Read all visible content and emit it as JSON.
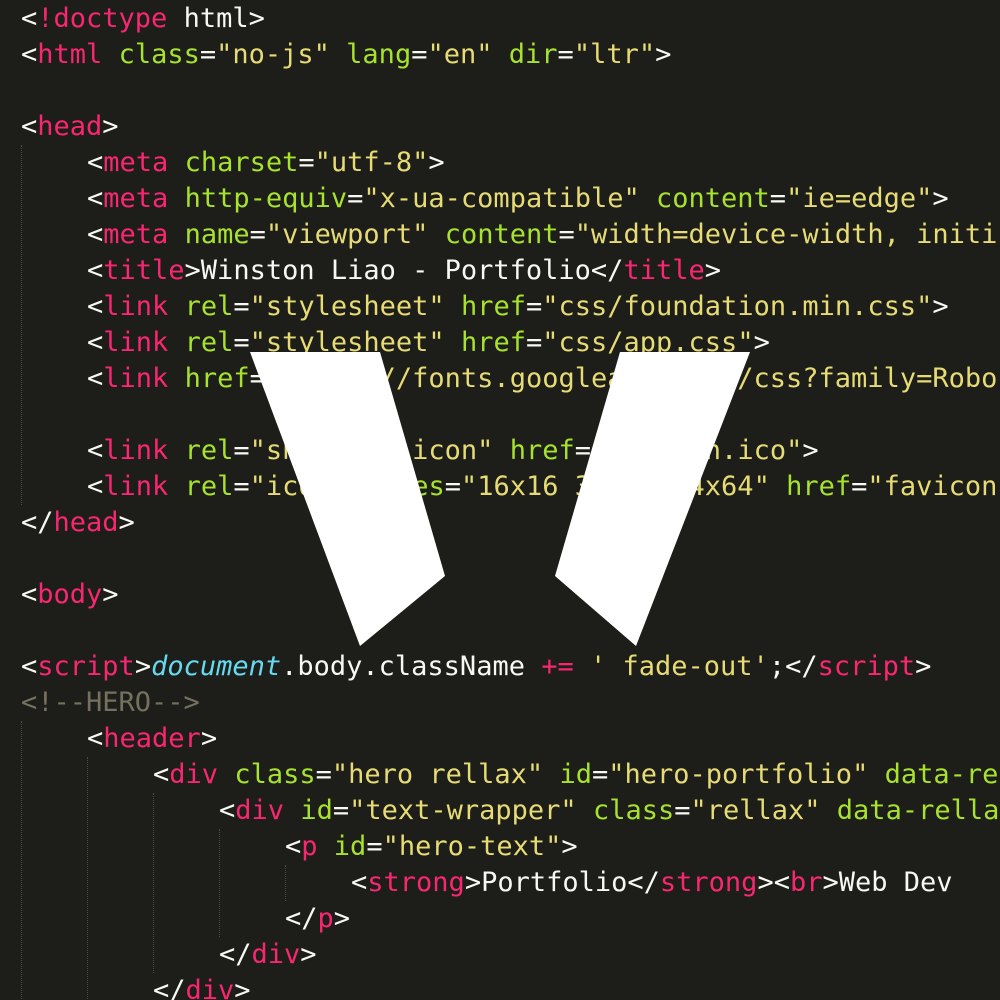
{
  "colors": {
    "background": "#1d1e19",
    "punctuation": "#f8f8f2",
    "tag": "#f92672",
    "attribute": "#a6e22e",
    "string": "#e6db74",
    "comment": "#75715e",
    "keyword": "#f92672",
    "builtin": "#66d9ef",
    "logo": "#ffffff"
  },
  "logo": {
    "icon": "white-chevron-logo-icon",
    "color": "#ffffff"
  },
  "lines": [
    {
      "indent": 0,
      "tokens": [
        [
          "p",
          "<"
        ],
        [
          "t",
          "!doctype"
        ],
        [
          "p",
          " html>"
        ]
      ]
    },
    {
      "indent": 0,
      "tokens": [
        [
          "p",
          "<"
        ],
        [
          "t",
          "html"
        ],
        [
          "p",
          " "
        ],
        [
          "a",
          "class"
        ],
        [
          "p",
          "="
        ],
        [
          "s",
          "\"no-js\""
        ],
        [
          "p",
          " "
        ],
        [
          "a",
          "lang"
        ],
        [
          "p",
          "="
        ],
        [
          "s",
          "\"en\""
        ],
        [
          "p",
          " "
        ],
        [
          "a",
          "dir"
        ],
        [
          "p",
          "="
        ],
        [
          "s",
          "\"ltr\""
        ],
        [
          "p",
          ">"
        ]
      ]
    },
    {
      "indent": 0,
      "tokens": []
    },
    {
      "indent": 0,
      "tokens": [
        [
          "p",
          "<"
        ],
        [
          "t",
          "head"
        ],
        [
          "p",
          ">"
        ]
      ]
    },
    {
      "indent": 1,
      "tokens": [
        [
          "p",
          "<"
        ],
        [
          "t",
          "meta"
        ],
        [
          "p",
          " "
        ],
        [
          "a",
          "charset"
        ],
        [
          "p",
          "="
        ],
        [
          "s",
          "\"utf-8\""
        ],
        [
          "p",
          ">"
        ]
      ]
    },
    {
      "indent": 1,
      "tokens": [
        [
          "p",
          "<"
        ],
        [
          "t",
          "meta"
        ],
        [
          "p",
          " "
        ],
        [
          "a",
          "http-equiv"
        ],
        [
          "p",
          "="
        ],
        [
          "s",
          "\"x-ua-compatible\""
        ],
        [
          "p",
          " "
        ],
        [
          "a",
          "content"
        ],
        [
          "p",
          "="
        ],
        [
          "s",
          "\"ie=edge\""
        ],
        [
          "p",
          ">"
        ]
      ]
    },
    {
      "indent": 1,
      "tokens": [
        [
          "p",
          "<"
        ],
        [
          "t",
          "meta"
        ],
        [
          "p",
          " "
        ],
        [
          "a",
          "name"
        ],
        [
          "p",
          "="
        ],
        [
          "s",
          "\"viewport\""
        ],
        [
          "p",
          " "
        ],
        [
          "a",
          "content"
        ],
        [
          "p",
          "="
        ],
        [
          "s",
          "\"width=device-width, initi"
        ]
      ]
    },
    {
      "indent": 1,
      "tokens": [
        [
          "p",
          "<"
        ],
        [
          "t",
          "title"
        ],
        [
          "p",
          ">Winston Liao - Portfolio</"
        ],
        [
          "t",
          "title"
        ],
        [
          "p",
          ">"
        ]
      ]
    },
    {
      "indent": 1,
      "tokens": [
        [
          "p",
          "<"
        ],
        [
          "t",
          "link"
        ],
        [
          "p",
          " "
        ],
        [
          "a",
          "rel"
        ],
        [
          "p",
          "="
        ],
        [
          "s",
          "\"stylesheet\""
        ],
        [
          "p",
          " "
        ],
        [
          "a",
          "href"
        ],
        [
          "p",
          "="
        ],
        [
          "s",
          "\"css/foundation.min.css\""
        ],
        [
          "p",
          ">"
        ]
      ]
    },
    {
      "indent": 1,
      "tokens": [
        [
          "p",
          "<"
        ],
        [
          "t",
          "link"
        ],
        [
          "p",
          " "
        ],
        [
          "a",
          "rel"
        ],
        [
          "p",
          "="
        ],
        [
          "s",
          "\"stylesheet\""
        ],
        [
          "p",
          " "
        ],
        [
          "a",
          "href"
        ],
        [
          "p",
          "="
        ],
        [
          "s",
          "\"css/app.css\""
        ],
        [
          "p",
          ">"
        ]
      ]
    },
    {
      "indent": 1,
      "tokens": [
        [
          "p",
          "<"
        ],
        [
          "t",
          "link"
        ],
        [
          "p",
          " "
        ],
        [
          "a",
          "href"
        ],
        [
          "p",
          "="
        ],
        [
          "s",
          "\"https://fonts.googleapis.com/css?family=Robo"
        ]
      ]
    },
    {
      "indent": 1,
      "tokens": []
    },
    {
      "indent": 1,
      "tokens": [
        [
          "p",
          "<"
        ],
        [
          "t",
          "link"
        ],
        [
          "p",
          " "
        ],
        [
          "a",
          "rel"
        ],
        [
          "p",
          "="
        ],
        [
          "s",
          "\"shortcut icon\""
        ],
        [
          "p",
          " "
        ],
        [
          "a",
          "href"
        ],
        [
          "p",
          "="
        ],
        [
          "s",
          "\"favicon.ico\""
        ],
        [
          "p",
          ">"
        ]
      ]
    },
    {
      "indent": 1,
      "tokens": [
        [
          "p",
          "<"
        ],
        [
          "t",
          "link"
        ],
        [
          "p",
          " "
        ],
        [
          "a",
          "rel"
        ],
        [
          "p",
          "="
        ],
        [
          "s",
          "\"icon\""
        ],
        [
          "p",
          " "
        ],
        [
          "a",
          "sizes"
        ],
        [
          "p",
          "="
        ],
        [
          "s",
          "\"16x16 32x32 64x64\""
        ],
        [
          "p",
          " "
        ],
        [
          "a",
          "href"
        ],
        [
          "p",
          "="
        ],
        [
          "s",
          "\"favicon"
        ]
      ]
    },
    {
      "indent": 0,
      "tokens": [
        [
          "p",
          "</"
        ],
        [
          "t",
          "head"
        ],
        [
          "p",
          ">"
        ]
      ]
    },
    {
      "indent": 0,
      "tokens": []
    },
    {
      "indent": 0,
      "tokens": [
        [
          "p",
          "<"
        ],
        [
          "t",
          "body"
        ],
        [
          "p",
          ">"
        ]
      ]
    },
    {
      "indent": 0,
      "tokens": []
    },
    {
      "indent": 0,
      "tokens": [
        [
          "p",
          "<"
        ],
        [
          "t",
          "script"
        ],
        [
          "p",
          ">"
        ],
        [
          "i",
          "document"
        ],
        [
          "p",
          ".body.className "
        ],
        [
          "k",
          "+="
        ],
        [
          "p",
          " "
        ],
        [
          "s",
          "' fade-out'"
        ],
        [
          "p",
          ";</"
        ],
        [
          "t",
          "script"
        ],
        [
          "p",
          ">"
        ]
      ]
    },
    {
      "indent": 0,
      "tokens": [
        [
          "c",
          "<!--HERO-->"
        ]
      ]
    },
    {
      "indent": 1,
      "tokens": [
        [
          "p",
          "<"
        ],
        [
          "t",
          "header"
        ],
        [
          "p",
          ">"
        ]
      ]
    },
    {
      "indent": 2,
      "tokens": [
        [
          "p",
          "<"
        ],
        [
          "t",
          "div"
        ],
        [
          "p",
          " "
        ],
        [
          "a",
          "class"
        ],
        [
          "p",
          "="
        ],
        [
          "s",
          "\"hero rellax\""
        ],
        [
          "p",
          " "
        ],
        [
          "a",
          "id"
        ],
        [
          "p",
          "="
        ],
        [
          "s",
          "\"hero-portfolio\""
        ],
        [
          "p",
          " "
        ],
        [
          "a",
          "data-re"
        ]
      ]
    },
    {
      "indent": 3,
      "tokens": [
        [
          "p",
          "<"
        ],
        [
          "t",
          "div"
        ],
        [
          "p",
          " "
        ],
        [
          "a",
          "id"
        ],
        [
          "p",
          "="
        ],
        [
          "s",
          "\"text-wrapper\""
        ],
        [
          "p",
          " "
        ],
        [
          "a",
          "class"
        ],
        [
          "p",
          "="
        ],
        [
          "s",
          "\"rellax\""
        ],
        [
          "p",
          " "
        ],
        [
          "a",
          "data-rella"
        ]
      ]
    },
    {
      "indent": 4,
      "tokens": [
        [
          "p",
          "<"
        ],
        [
          "t",
          "p"
        ],
        [
          "p",
          " "
        ],
        [
          "a",
          "id"
        ],
        [
          "p",
          "="
        ],
        [
          "s",
          "\"hero-text\""
        ],
        [
          "p",
          ">"
        ]
      ]
    },
    {
      "indent": 5,
      "tokens": [
        [
          "p",
          "<"
        ],
        [
          "t",
          "strong"
        ],
        [
          "p",
          ">Portfolio</"
        ],
        [
          "t",
          "strong"
        ],
        [
          "p",
          "><"
        ],
        [
          "t",
          "br"
        ],
        [
          "p",
          ">Web Dev"
        ]
      ]
    },
    {
      "indent": 4,
      "tokens": [
        [
          "p",
          "</"
        ],
        [
          "t",
          "p"
        ],
        [
          "p",
          ">"
        ]
      ]
    },
    {
      "indent": 3,
      "tokens": [
        [
          "p",
          "</"
        ],
        [
          "t",
          "div"
        ],
        [
          "p",
          ">"
        ]
      ]
    },
    {
      "indent": 2,
      "tokens": [
        [
          "p",
          "</"
        ],
        [
          "t",
          "div"
        ],
        [
          "p",
          ">"
        ]
      ]
    }
  ]
}
